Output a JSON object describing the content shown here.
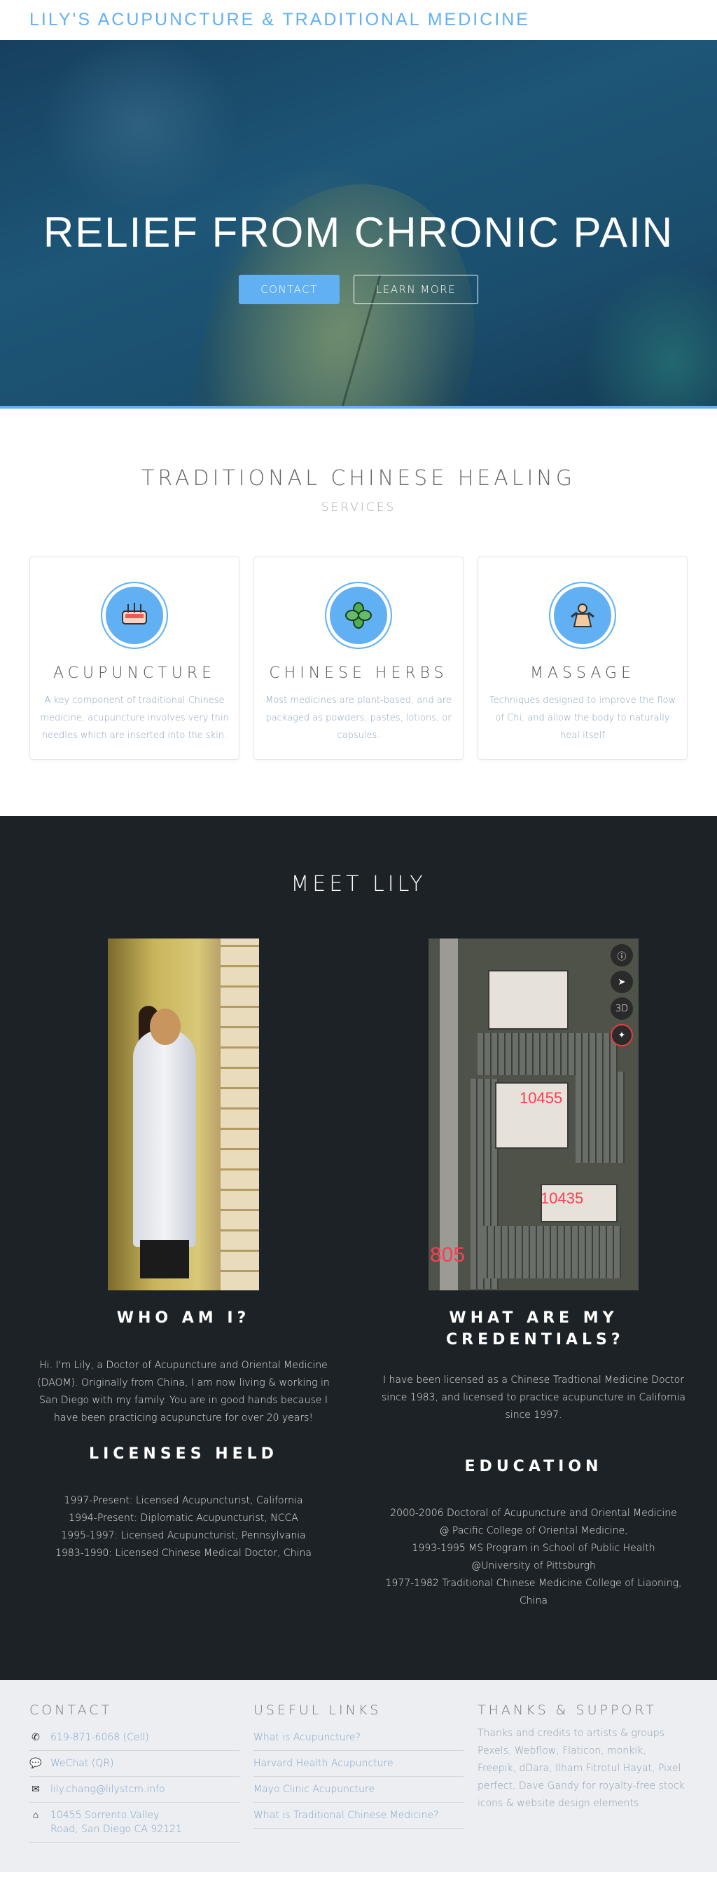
{
  "nav": {
    "brand": "LILY'S ACUPUNCTURE & TRADITIONAL MEDICINE"
  },
  "hero": {
    "title": "RELIEF FROM CHRONIC PAIN",
    "contact_label": "CONTACT",
    "learn_more_label": "LEARN MORE"
  },
  "services": {
    "title": "TRADITIONAL CHINESE HEALING",
    "subtitle": "SERVICES",
    "cards": [
      {
        "icon": "acupuncture-icon",
        "title": "ACUPUNCTURE",
        "text": "A key component of traditional Chinese medicine, acupuncture involves very thin needles which are inserted into the skin."
      },
      {
        "icon": "herbs-icon",
        "title": "CHINESE HERBS",
        "text": "Most medicines are plant-based, and are packaged as powders, pastes, lotions, or capsules."
      },
      {
        "icon": "massage-icon",
        "title": "MASSAGE",
        "text": "Techniques designed to improve the flow of Chi, and allow the body to naturally heal itself"
      }
    ]
  },
  "about": {
    "title": "MEET LILY",
    "who": {
      "title": "WHO AM I?",
      "text": "Hi. I'm Lily, a Doctor of Acupuncture and Oriental Medicine (DAOM). Originally from China, I am now living & working in San Diego with my family. You are in good hands because I have been practicing acupuncture for over 20 years!"
    },
    "credentials": {
      "title": "WHAT ARE MY CREDENTIALS?",
      "text": "I have been licensed as a Chinese Tradtional Medicine Doctor since 1983, and licensed to practice acupuncture in California since 1997."
    },
    "licenses": {
      "title": "LICENSES HELD",
      "items": [
        "1997-Present: Licensed Acupuncturist, California",
        "1994-Present: Diplomatic Acupuncturist, NCCA",
        "1995-1997: Licensed Acupuncturist, Pennsylvania",
        "1983-1990: Licensed Chinese Medical Doctor, China"
      ]
    },
    "education": {
      "title": "EDUCATION",
      "items": [
        "2000-2006 Doctoral of Acupuncture and Oriental Medicine",
        "@ Pacific College of Oriental Medicine,",
        "1993-1995 MS Program in School of Public Health",
        "@University of Pittsburgh",
        "1977-1982 Traditional Chinese Medicine College of Liaoning, China"
      ]
    },
    "map": {
      "street": "Sorrento Valley Road",
      "labels": [
        "10455",
        "10435",
        "805"
      ],
      "ctrl_3d": "3D"
    }
  },
  "footer": {
    "contact_title": "CONTACT",
    "contact_items": [
      {
        "icon": "phone-icon",
        "text": "619-871-6068 (Cell)"
      },
      {
        "icon": "wechat-icon",
        "text": "WeChat (QR)"
      },
      {
        "icon": "mail-icon",
        "text": "lily.chang@lilystcm.info"
      },
      {
        "icon": "home-icon",
        "text": "10455 Sorrento Valley Road, San Diego CA 92121"
      }
    ],
    "links_title": "USEFUL LINKS",
    "links": [
      "What is Acupuncture?",
      "Harvard Health Acupuncture",
      "Mayo Clinic Acupuncture",
      "What is Traditional Chinese Medicine?"
    ],
    "thanks_title": "THANKS & SUPPORT",
    "thanks_text": "Thanks and credits to artists & groups Pexels, Webflow, Flaticon, monkik, Freepik, dDara, Ilham Fitrotul Hayat, Pixel perfect, Dave Gandy for royalty-free stock icons & website design elements"
  }
}
